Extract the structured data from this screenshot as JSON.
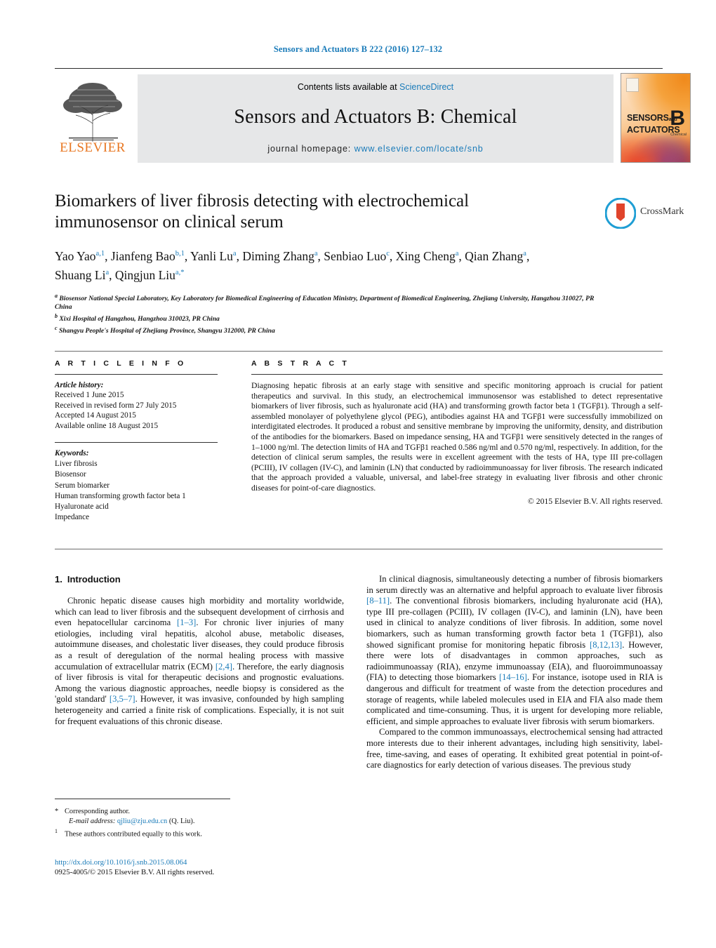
{
  "running_head": "Sensors and Actuators B 222 (2016) 127–132",
  "masthead": {
    "publisher_name": "ELSEVIER",
    "contents_prefix": "Contents lists available at ",
    "contents_link": "ScienceDirect",
    "journal_title": "Sensors and Actuators B: Chemical",
    "homepage_prefix": "journal homepage: ",
    "homepage_url": "www.elsevier.com/locate/snb",
    "cover": {
      "line1": "SENSORS",
      "and": "and",
      "line2": "ACTUATORS",
      "letter": "B",
      "sub": "Chemical"
    },
    "accent_blue": "#1a7bb9",
    "elsevier_orange": "#e87722"
  },
  "article": {
    "title": "Biomarkers of liver fibrosis detecting with electrochemical immunosensor on clinical serum",
    "authors": [
      {
        "name": "Yao Yao",
        "marks": "a,1",
        "sep": ", "
      },
      {
        "name": "Jianfeng Bao",
        "marks": "b,1",
        "sep": ", "
      },
      {
        "name": "Yanli Lu",
        "marks": "a",
        "sep": ", "
      },
      {
        "name": "Diming Zhang",
        "marks": "a",
        "sep": ", "
      },
      {
        "name": "Senbiao Luo",
        "marks": "c",
        "sep": ", "
      },
      {
        "name": "Xing Cheng",
        "marks": "a",
        "sep": ", "
      },
      {
        "name": "Qian Zhang",
        "marks": "a",
        "sep": ", "
      },
      {
        "name": "Shuang Li",
        "marks": "a",
        "sep": ", "
      },
      {
        "name": "Qingjun Liu",
        "marks": "a,*",
        "sep": ""
      }
    ],
    "affiliations": [
      {
        "mark": "a",
        "text": "Biosensor National Special Laboratory, Key Laboratory for Biomedical Engineering of Education Ministry, Department of Biomedical Engineering, Zhejiang University, Hangzhou 310027, PR China"
      },
      {
        "mark": "b",
        "text": "Xixi Hospital of Hangzhou, Hangzhou 310023, PR China"
      },
      {
        "mark": "c",
        "text": "Shangyu People's Hospital of Zhejiang Province, Shangyu 312000, PR China"
      }
    ],
    "crossmark_label": "CrossMark"
  },
  "article_info": {
    "heading": "A R T I C L E  I N F O",
    "history_label": "Article history:",
    "history": [
      "Received 1 June 2015",
      "Received in revised form 27 July 2015",
      "Accepted 14 August 2015",
      "Available online 18 August 2015"
    ],
    "keywords_label": "Keywords:",
    "keywords": [
      "Liver fibrosis",
      "Biosensor",
      "Serum biomarker",
      "Human transforming growth factor beta 1",
      "Hyaluronate acid",
      "Impedance"
    ]
  },
  "abstract": {
    "heading": "A B S T R A C T",
    "text": "Diagnosing hepatic fibrosis at an early stage with sensitive and specific monitoring approach is crucial for patient therapeutics and survival. In this study, an electrochemical immunosensor was established to detect representative biomarkers of liver fibrosis, such as hyaluronate acid (HA) and transforming growth factor beta 1 (TGFβ1). Through a self-assembled monolayer of polyethylene glycol (PEG), antibodies against HA and TGFβ1 were successfully immobilized on interdigitated electrodes. It produced a robust and sensitive membrane by improving the uniformity, density, and distribution of the antibodies for the biomarkers. Based on impedance sensing, HA and TGFβ1 were sensitively detected in the ranges of 1–1000 ng/ml. The detection limits of HA and TGFβ1 reached 0.586 ng/ml and 0.570 ng/ml, respectively. In addition, for the detection of clinical serum samples, the results were in excellent agreement with the tests of HA, type III pre-collagen (PCIII), IV collagen (IV-C), and laminin (LN) that conducted by radioimmunoassay for liver fibrosis. The research indicated that the approach provided a valuable, universal, and label-free strategy in evaluating liver fibrosis and other chronic diseases for point-of-care diagnostics.",
    "copyright": "© 2015 Elsevier B.V. All rights reserved."
  },
  "section": {
    "number": "1.",
    "heading": "Introduction"
  },
  "body": {
    "left": [
      "Chronic hepatic disease causes high morbidity and mortality worldwide, which can lead to liver fibrosis and the subsequent development of cirrhosis and even hepatocellular carcinoma [1–3]. For chronic liver injuries of many etiologies, including viral hepatitis, alcohol abuse, metabolic diseases, autoimmune diseases, and cholestatic liver diseases, they could produce fibrosis as a result of deregulation of the normal healing process with massive accumulation of extracellular matrix (ECM) [2,4]. Therefore, the early diagnosis of liver fibrosis is vital for therapeutic decisions and prognostic evaluations. Among the various diagnostic approaches, needle biopsy is considered as the 'gold standard' [3,5–7]. However, it was invasive, confounded by high sampling heterogeneity and carried a finite risk of complications. Especially, it is not suit for frequent evaluations of this chronic disease."
    ],
    "right": [
      "In clinical diagnosis, simultaneously detecting a number of fibrosis biomarkers in serum directly was an alternative and helpful approach to evaluate liver fibrosis [8–11]. The conventional fibrosis biomarkers, including hyaluronate acid (HA), type III pre-collagen (PCIII), IV collagen (IV-C), and laminin (LN), have been used in clinical to analyze conditions of liver fibrosis. In addition, some novel biomarkers, such as human transforming growth factor beta 1 (TGFβ1), also showed significant promise for monitoring hepatic fibrosis [8,12,13]. However, there were lots of disadvantages in common approaches, such as radioimmunoassay (RIA), enzyme immunoassay (EIA), and fluoroimmunoassay (FIA) to detecting those biomarkers [14–16]. For instance, isotope used in RIA is dangerous and difficult for treatment of waste from the detection procedures and storage of reagents, while labeled molecules used in EIA and FIA also made them complicated and time-consuming. Thus, it is urgent for developing more reliable, efficient, and simple approaches to evaluate liver fibrosis with serum biomarkers.",
      "Compared to the common immunoassays, electrochemical sensing had attracted more interests due to their inherent advantages, including high sensitivity, label-free, time-saving, and eases of operating. It exhibited great potential in point-of-care diagnostics for early detection of various diseases. The previous study"
    ]
  },
  "footnotes": {
    "corresponding_marker": "*",
    "corresponding_text": "Corresponding author.",
    "email_label": "E-mail address:",
    "email": "qjliu@zju.edu.cn",
    "email_suffix": "(Q. Liu).",
    "equal_marker": "1",
    "equal_text": "These authors contributed equally to this work."
  },
  "footer": {
    "doi": "http://dx.doi.org/10.1016/j.snb.2015.08.064",
    "issn_line": "0925-4005/© 2015 Elsevier B.V. All rights reserved."
  }
}
